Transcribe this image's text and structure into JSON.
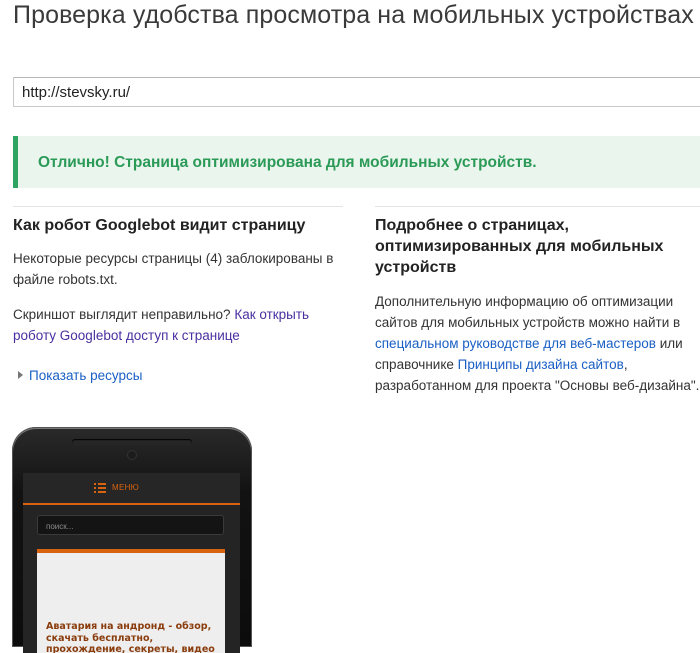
{
  "page": {
    "title": "Проверка удобства просмотра на мобильных устройствах"
  },
  "url_input": {
    "value": "http://stevsky.ru/"
  },
  "result": {
    "message": "Отлично! Страница оптимизирована для мобильных устройств.",
    "accent_color": "#2fa361"
  },
  "googlebot": {
    "heading": "Как робот Googlebot видит страницу",
    "blocked_text": "Некоторые ресурсы страницы (4) заблокированы в файле robots.txt.",
    "screenshot_question": "Скриншот выглядит неправильно?",
    "access_link": "Как открыть роботу Googlebot доступ к странице",
    "show_resources": "Показать ресурсы"
  },
  "more_info": {
    "heading": "Подробнее о страницах, оптимизированных для мобильных устройств",
    "text_1": "Дополнительную информацию об оптимизации сайтов для мобильных устройств можно найти в",
    "link_1": "специальном руководстве для веб-мастеров",
    "text_2": "или справочнике",
    "link_2": "Принципы дизайна сайтов",
    "text_3": ", разработанном для проекта \"Основы веб-дизайна\"."
  },
  "phone_preview": {
    "menu_label": "МЕНЮ",
    "search_placeholder": "поиск...",
    "article_title": "Аватария на андронд - обзор, скачать бесплатно, прохождение, секреты, видео",
    "accent_color": "#d8630f"
  }
}
